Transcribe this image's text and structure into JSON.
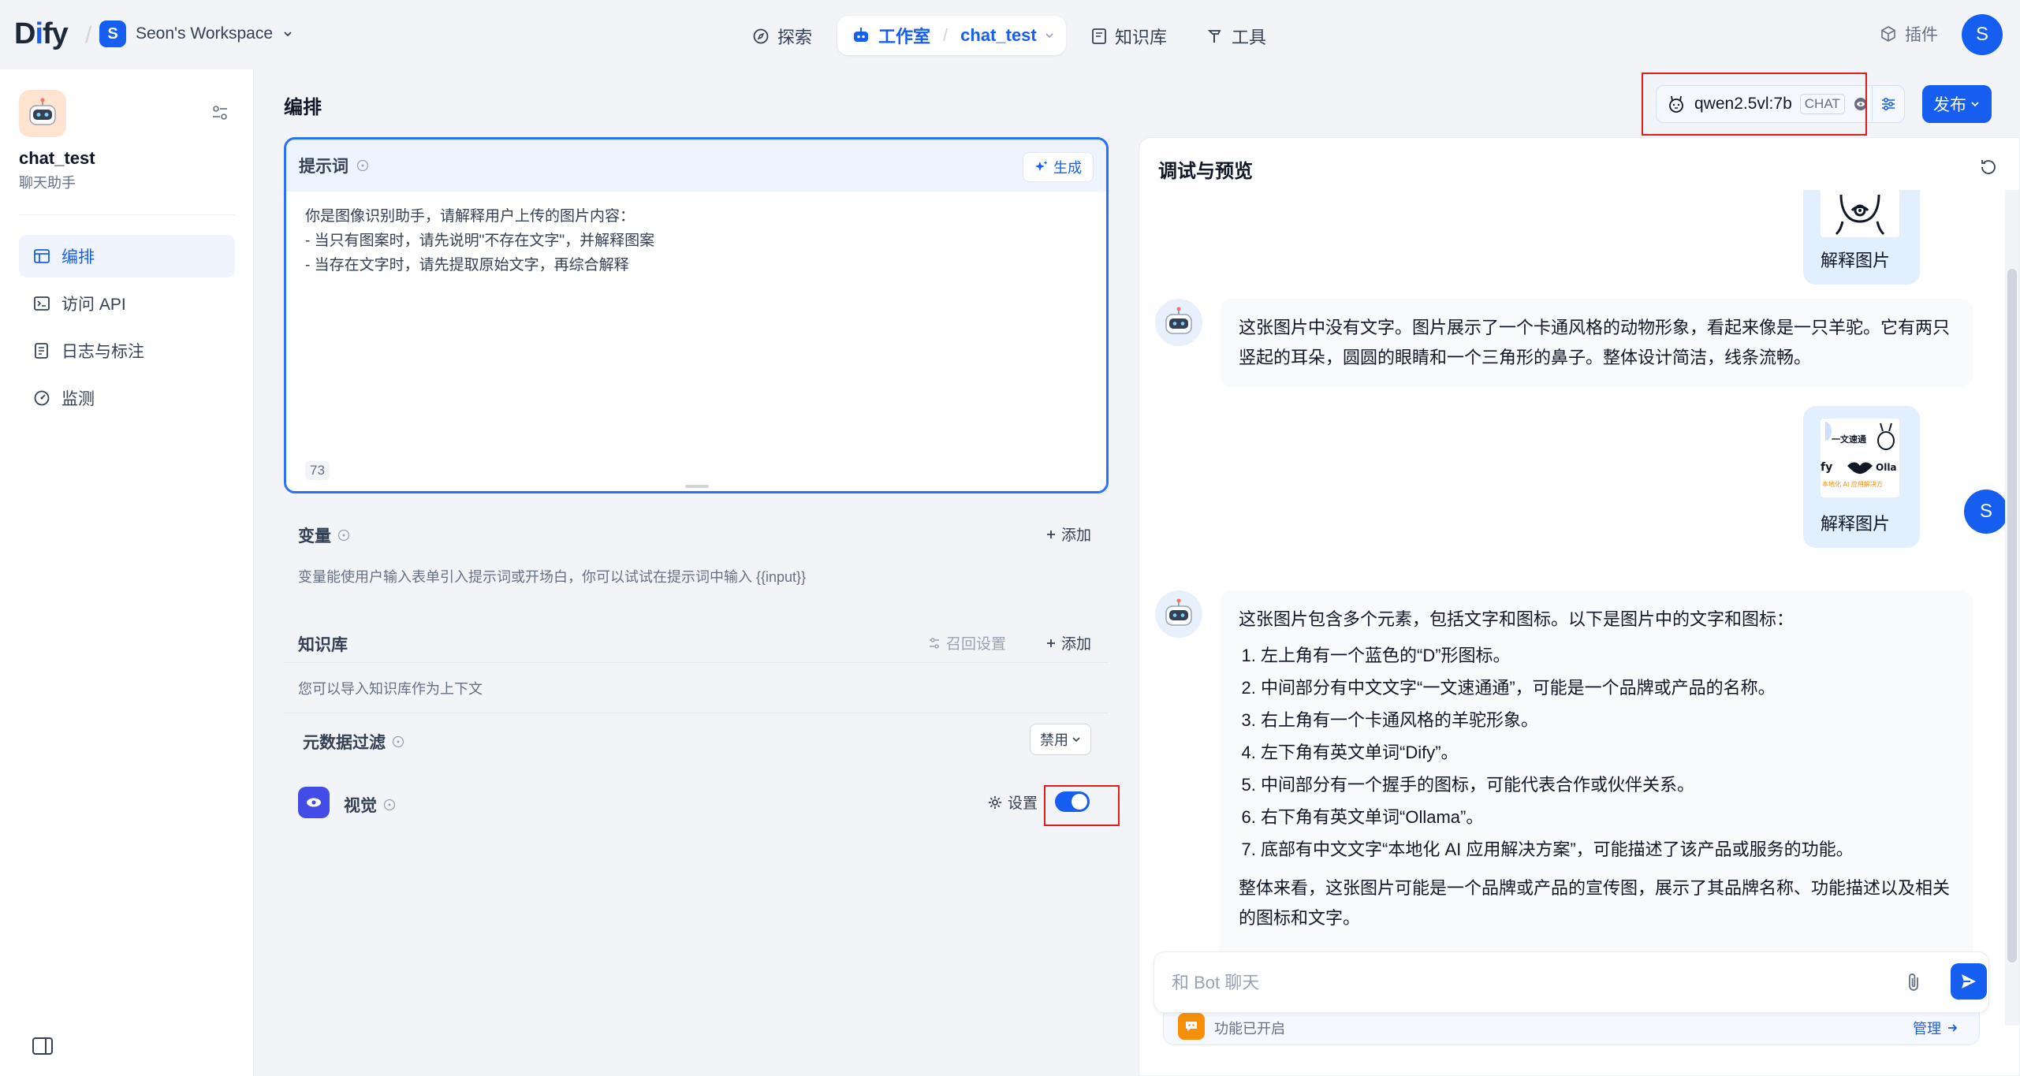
{
  "topnav": {
    "logo_pre": "D",
    "logo_i": "i",
    "logo_post": "fy",
    "workspace_initial": "S",
    "workspace_name": "Seon's Workspace",
    "explore": "探索",
    "studio": "工作室",
    "app_crumb": "chat_test",
    "knowledge": "知识库",
    "tools": "工具",
    "plugins": "插件",
    "user_initial": "S"
  },
  "sidebar": {
    "app_name": "chat_test",
    "app_type": "聊天助手",
    "items": [
      {
        "label": "编排",
        "icon": "layout-icon",
        "active": true
      },
      {
        "label": "访问 API",
        "icon": "terminal-icon",
        "active": false
      },
      {
        "label": "日志与标注",
        "icon": "file-list-icon",
        "active": false
      },
      {
        "label": "监测",
        "icon": "dashboard-icon",
        "active": false
      }
    ]
  },
  "header": {
    "title": "编排",
    "model_name": "qwen2.5vl:7b",
    "model_mode": "CHAT",
    "publish_label": "发布"
  },
  "prompt": {
    "label": "提示词",
    "generate_label": "生成",
    "lines": [
      "你是图像识别助手，请解释用户上传的图片内容：",
      "- 当只有图案时，请先说明\"不存在文字\"，并解释图案",
      "- 当存在文字时，请先提取原始文字，再综合解释"
    ],
    "char_count": "73"
  },
  "variables": {
    "title": "变量",
    "add_label": "添加",
    "description": "变量能使用户输入表单引入提示词或开场白，你可以试试在提示词中输入 {{input}}"
  },
  "knowledge": {
    "title": "知识库",
    "recall_label": "召回设置",
    "add_label": "添加",
    "description": "您可以导入知识库作为上下文",
    "metadata_label": "元数据过滤",
    "metadata_value": "禁用"
  },
  "vision": {
    "title": "视觉",
    "settings_label": "设置",
    "enabled": true
  },
  "debug": {
    "title": "调试与预览",
    "messages": {
      "user1_caption": "解释图片",
      "bot1_text": "这张图片中没有文字。图片展示了一个卡通风格的动物形象，看起来像是一只羊驼。它有两只竖起的耳朵，圆圆的眼睛和一个三角形的鼻子。整体设计简洁，线条流畅。",
      "user2_caption": "解释图片",
      "user2_thumb": {
        "line1": "一文速通",
        "line2_left": "fy",
        "line2_right": "Olla",
        "line3": "本地化 AI 应用解决方"
      },
      "user_initial": "S",
      "bot2_intro": "这张图片包含多个元素，包括文字和图标。以下是图片中的文字和图标：",
      "bot2_items": [
        "左上角有一个蓝色的“D”形图标。",
        "中间部分有中文文字“一文速通通”，可能是一个品牌或产品的名称。",
        "右上角有一个卡通风格的羊驼形象。",
        "左下角有英文单词“Dify”。",
        "中间部分有一个握手的图标，可能代表合作或伙伴关系。",
        "右下角有英文单词“Ollama”。",
        "底部有中文文字“本地化 AI 应用解决方案”，可能描述了该产品或服务的功能。"
      ],
      "bot2_summary": "整体来看，这张图片可能是一个品牌或产品的宣传图，展示了其品牌名称、功能描述以及相关的图标和文字。"
    },
    "input_placeholder": "和 Bot 聊天",
    "features_text": "功能已开启",
    "manage_label": "管理"
  },
  "colors": {
    "accent": "#155eef",
    "highlight": "#e11d1d"
  }
}
